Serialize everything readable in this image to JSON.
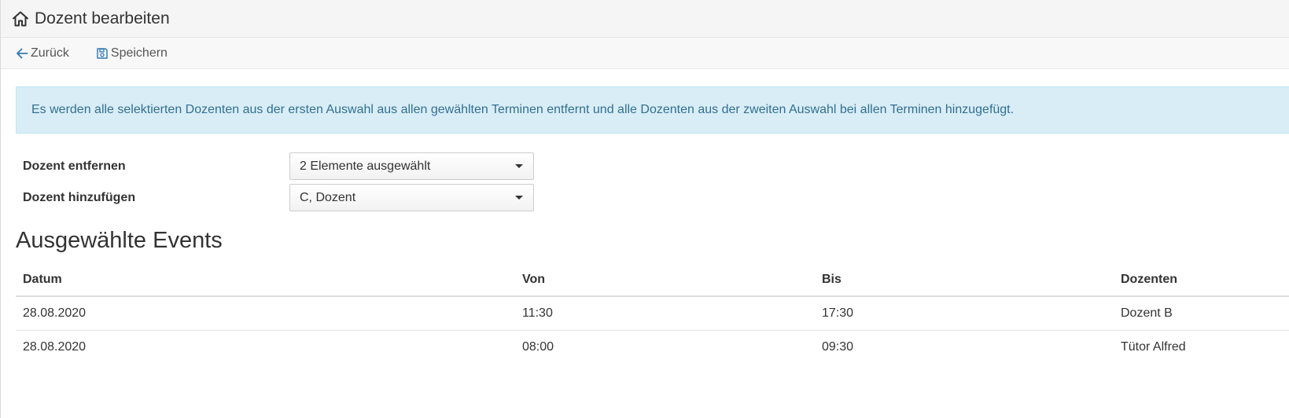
{
  "header": {
    "title": "Dozent bearbeiten",
    "icon": "home-icon"
  },
  "toolbar": {
    "back_label": "Zurück",
    "back_icon": "arrow-left-icon",
    "save_label": "Speichern",
    "save_icon": "floppy-disk-icon"
  },
  "info": {
    "text": "Es werden alle selektierten Dozenten aus der ersten Auswahl aus allen gewählten Terminen entfernt und alle Dozenten aus der zweiten Auswahl bei allen Terminen hinzugefügt."
  },
  "form": {
    "remove": {
      "label": "Dozent entfernen",
      "value": "2 Elemente ausgewählt"
    },
    "add": {
      "label": "Dozent hinzufügen",
      "value": "C, Dozent"
    }
  },
  "events": {
    "title": "Ausgewählte Events",
    "columns": [
      "Datum",
      "Von",
      "Bis",
      "Dozenten"
    ],
    "rows": [
      [
        "28.08.2020",
        "11:30",
        "17:30",
        "Dozent B"
      ],
      [
        "28.08.2020",
        "08:00",
        "09:30",
        "Tütor Alfred"
      ]
    ]
  },
  "colors": {
    "info_background": "#d9edf7",
    "info_text": "#31708f",
    "accent_icon": "#337ab7"
  }
}
